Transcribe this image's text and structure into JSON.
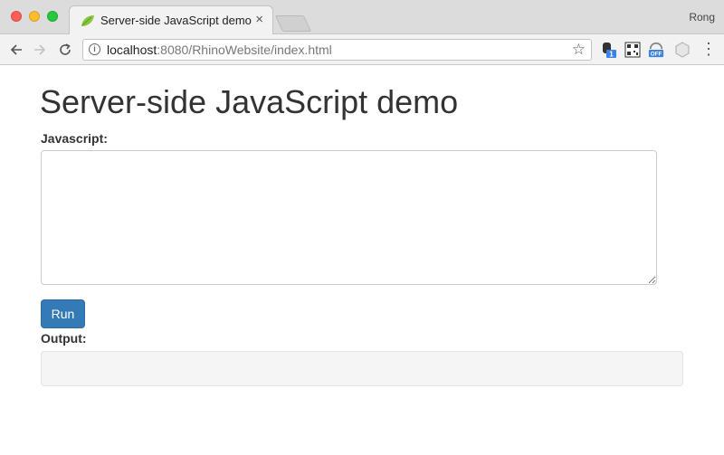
{
  "browser": {
    "tab_title": "Server-side JavaScript demo",
    "tab_close": "×",
    "profile_name": "Rong",
    "url_host": "localhost",
    "url_rest": ":8080/RhinoWebsite/index.html",
    "ext_badges": [
      "1",
      "OFF"
    ]
  },
  "page": {
    "title": "Server-side JavaScript demo",
    "javascript_label": "Javascript:",
    "javascript_value": "",
    "run_label": "Run",
    "output_label": "Output:",
    "output_value": ""
  },
  "colors": {
    "run_button": "#337ab7",
    "output_bg": "#f5f5f5"
  }
}
